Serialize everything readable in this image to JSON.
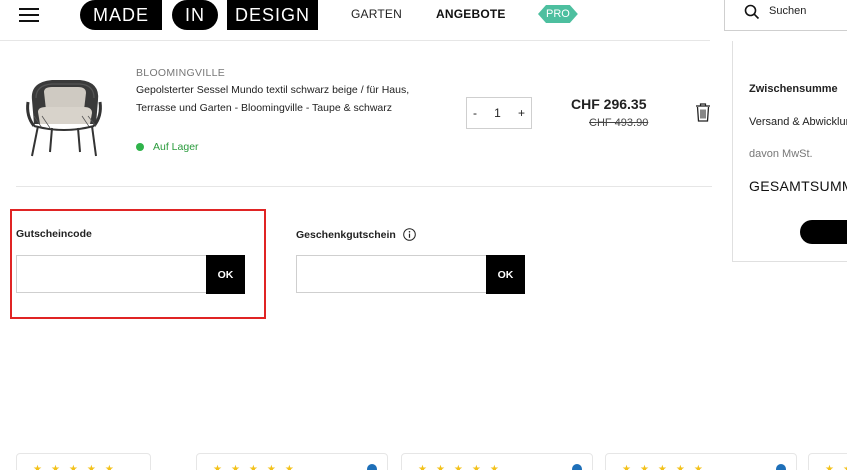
{
  "header": {
    "logo": [
      "MADE",
      "IN",
      "DESIGN"
    ],
    "nav": {
      "garten": "GARTEN",
      "angebote": "ANGEBOTE",
      "pro": "PRO"
    },
    "search_placeholder": "Suchen"
  },
  "cart_item": {
    "brand": "BLOOMINGVILLE",
    "title": "Gepolsterter Sessel Mundo textil schwarz beige / für Haus, Terrasse und Garten - Bloomingville - Taupe & schwarz",
    "stock": "Auf Lager",
    "quantity": {
      "minus": "-",
      "value": "1",
      "plus": "+"
    },
    "price": "CHF 296.35",
    "old_price": "CHF 493.90"
  },
  "vouchers": {
    "coupon_label": "Gutscheincode",
    "gift_label": "Geschenkgutschein",
    "ok_label": "OK"
  },
  "summary": {
    "subtotal": "Zwischensumme",
    "shipping": "Versand & Abwicklung",
    "vat": "davon MwSt.",
    "total": "GESAMTSUMME"
  },
  "colors": {
    "accent_pro": "#4dbf9f",
    "in_stock": "#2fb34a",
    "highlight": "#e02424",
    "stars": "#f3c21b"
  }
}
